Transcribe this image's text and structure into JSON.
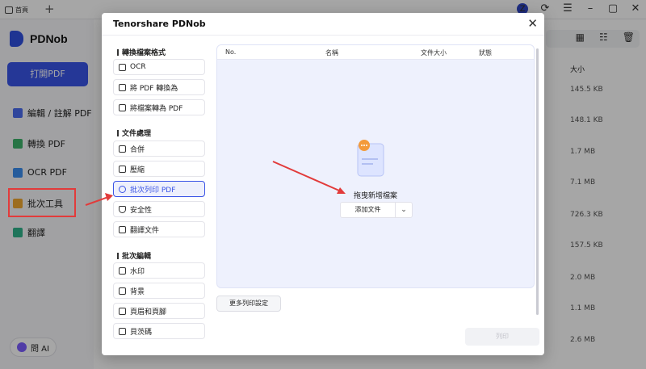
{
  "titlebar": {
    "tab_label": "首頁",
    "avatar_letter": "z"
  },
  "app_sidebar": {
    "brand": "PDNob",
    "open_button": "打開PDF",
    "items": [
      {
        "label": "編輯 / 註解 PDF",
        "icon": "edit-icon"
      },
      {
        "label": "轉換 PDF",
        "icon": "convert-icon"
      },
      {
        "label": "OCR PDF",
        "icon": "ocr-icon"
      },
      {
        "label": "批次工具",
        "icon": "batch-tools-icon"
      },
      {
        "label": "翻譯",
        "icon": "translate-icon"
      }
    ],
    "ai_button": "問 AI"
  },
  "app_main": {
    "size_header": "大小",
    "sizes": [
      "145.5 KB",
      "148.1 KB",
      "1.7 MB",
      "7.1 MB",
      "726.3 KB",
      "157.5 KB",
      "2.0 MB",
      "1.1 MB",
      "2.6 MB"
    ]
  },
  "dialog": {
    "title": "Tenorshare PDNob",
    "sections": [
      {
        "title": "轉換檔案格式",
        "items": [
          "OCR",
          "將 PDF 轉換為",
          "將檔案轉為 PDF"
        ]
      },
      {
        "title": "文件處理",
        "items": [
          "合併",
          "壓縮",
          "批次列印 PDF",
          "安全性",
          "翻譯文件"
        ]
      },
      {
        "title": "批次編輯",
        "items": [
          "水印",
          "背景",
          "頁眉和頁腳",
          "貝茨碼"
        ]
      }
    ],
    "active_item": "批次列印 PDF",
    "table_headers": [
      "No.",
      "名稱",
      "文件大小",
      "狀態"
    ],
    "drop_text": "拖曳新增檔案",
    "add_button": "添加文件",
    "more_settings_button": "更多列印設定",
    "print_button": "列印",
    "colors": {
      "accent": "#3b55e6",
      "annotation": "#e23b3b"
    }
  }
}
